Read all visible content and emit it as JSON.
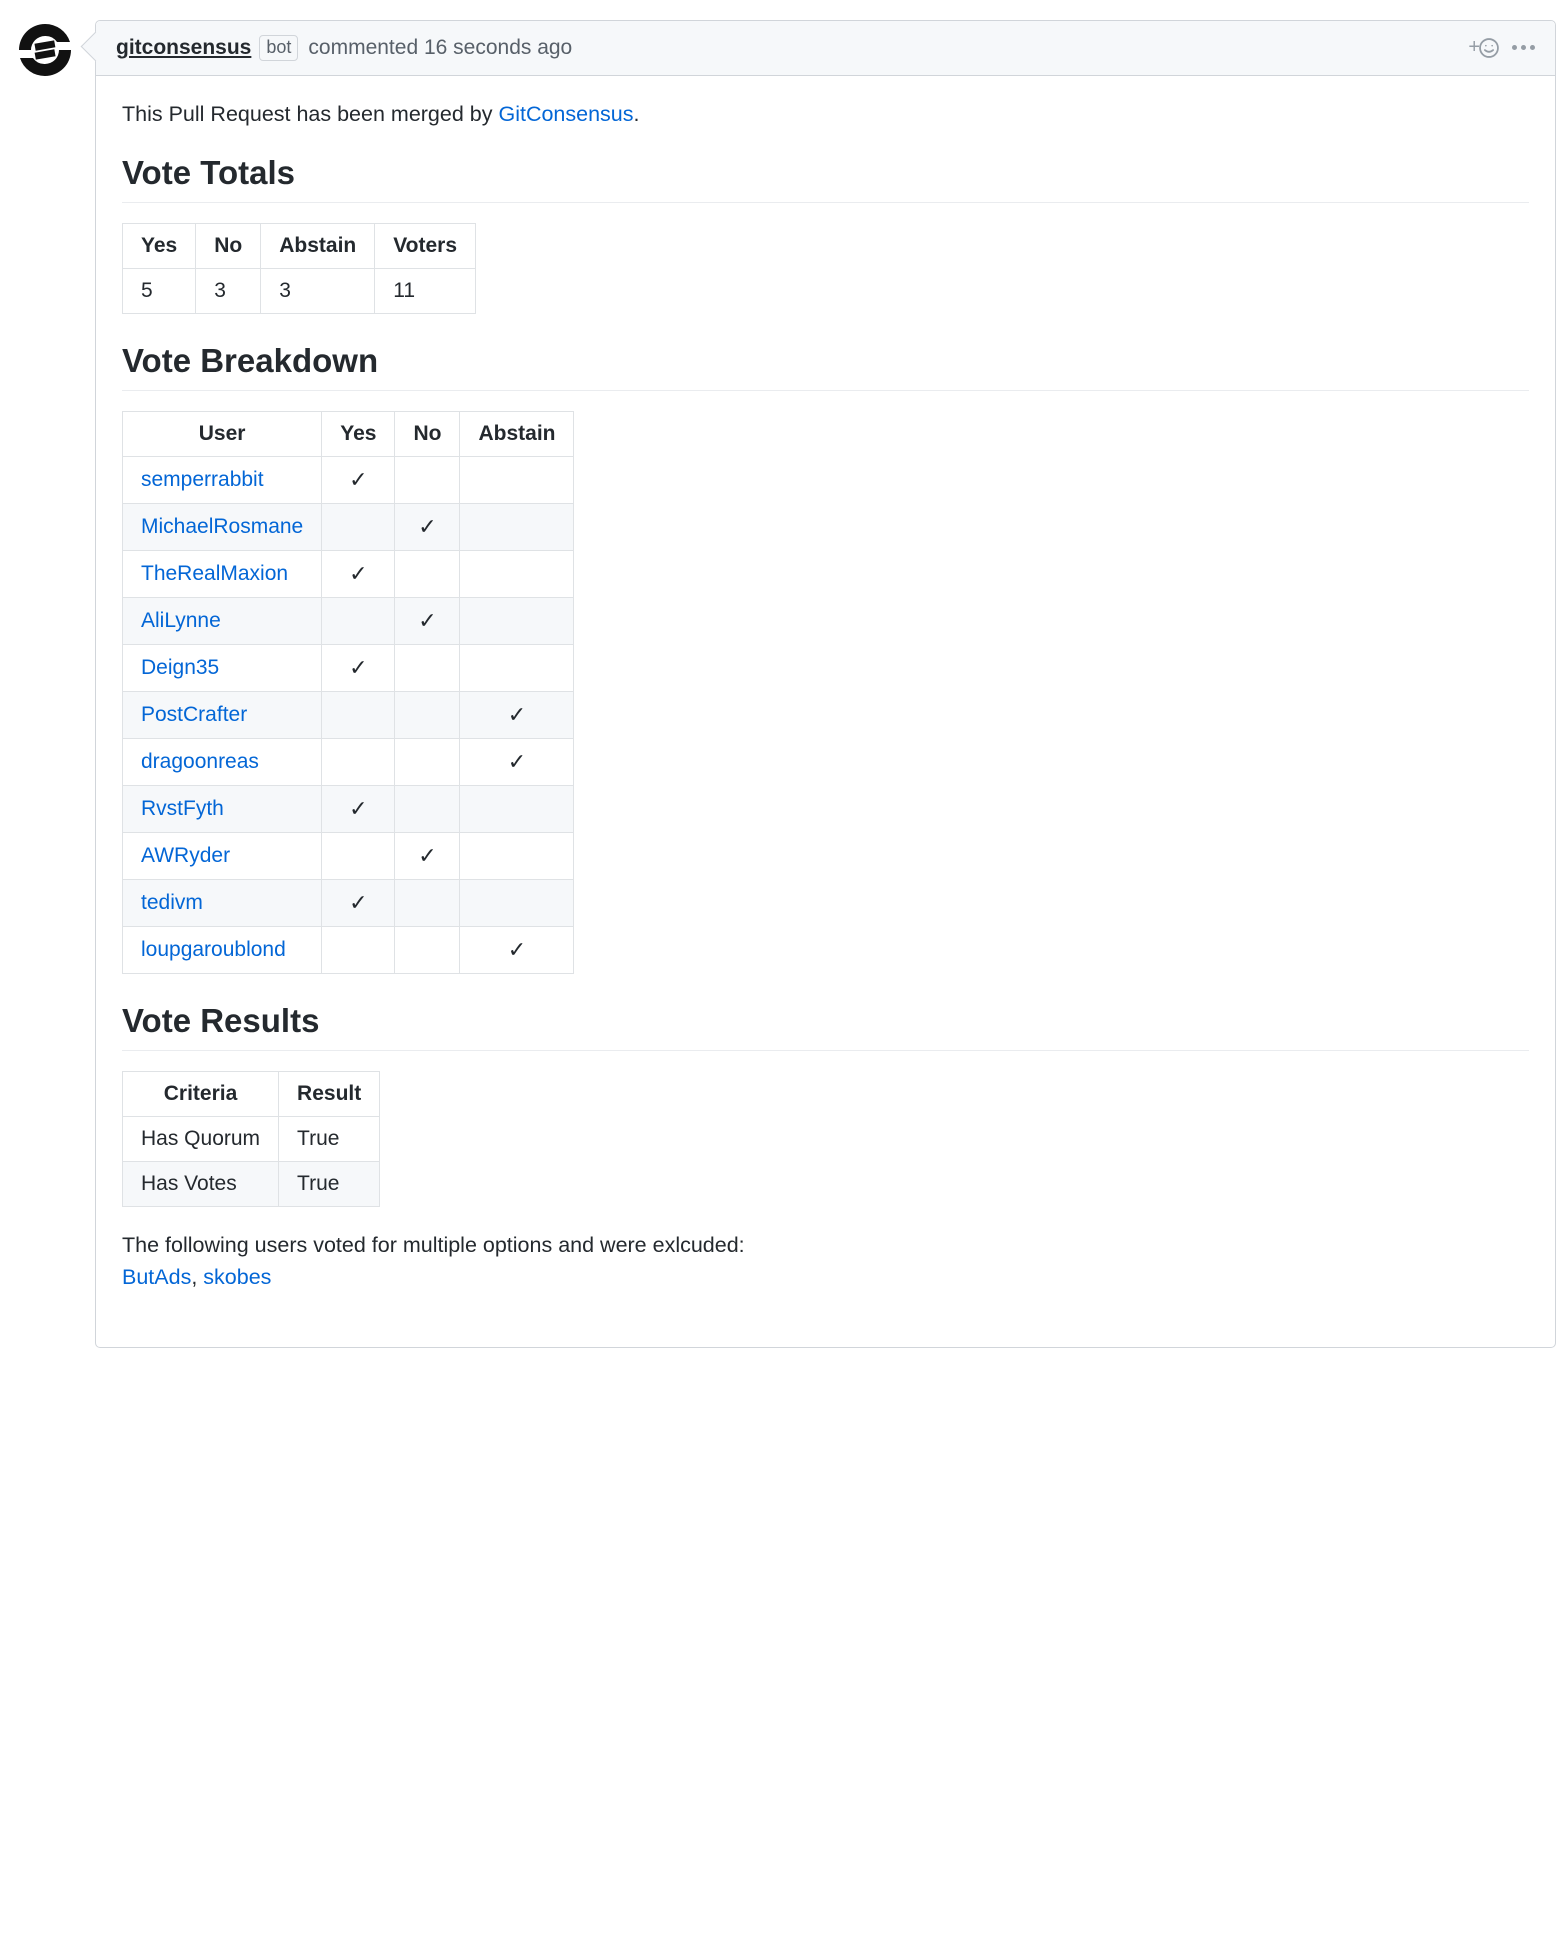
{
  "header": {
    "author": "gitconsensus",
    "bot_label": "bot",
    "action_text": "commented 16 seconds ago"
  },
  "intro": {
    "prefix": "This Pull Request has been merged by ",
    "link_text": "GitConsensus",
    "suffix": "."
  },
  "sections": {
    "totals_heading": "Vote Totals",
    "breakdown_heading": "Vote Breakdown",
    "results_heading": "Vote Results"
  },
  "totals": {
    "headers": {
      "yes": "Yes",
      "no": "No",
      "abstain": "Abstain",
      "voters": "Voters"
    },
    "values": {
      "yes": "5",
      "no": "3",
      "abstain": "3",
      "voters": "11"
    }
  },
  "breakdown": {
    "headers": {
      "user": "User",
      "yes": "Yes",
      "no": "No",
      "abstain": "Abstain"
    },
    "check_glyph": "✓",
    "rows": [
      {
        "user": "semperrabbit",
        "vote": "yes"
      },
      {
        "user": "MichaelRosmane",
        "vote": "no"
      },
      {
        "user": "TheRealMaxion",
        "vote": "yes"
      },
      {
        "user": "AliLynne",
        "vote": "no"
      },
      {
        "user": "Deign35",
        "vote": "yes"
      },
      {
        "user": "PostCrafter",
        "vote": "abstain"
      },
      {
        "user": "dragoonreas",
        "vote": "abstain"
      },
      {
        "user": "RvstFyth",
        "vote": "yes"
      },
      {
        "user": "AWRyder",
        "vote": "no"
      },
      {
        "user": "tedivm",
        "vote": "yes"
      },
      {
        "user": "loupgaroublond",
        "vote": "abstain"
      }
    ]
  },
  "results": {
    "headers": {
      "criteria": "Criteria",
      "result": "Result"
    },
    "rows": [
      {
        "criteria": "Has Quorum",
        "result": "True"
      },
      {
        "criteria": "Has Votes",
        "result": "True"
      }
    ]
  },
  "excluded": {
    "text": "The following users voted for multiple options and were exlcuded:",
    "separator": ", ",
    "users": [
      "ButAds",
      "skobes"
    ]
  }
}
